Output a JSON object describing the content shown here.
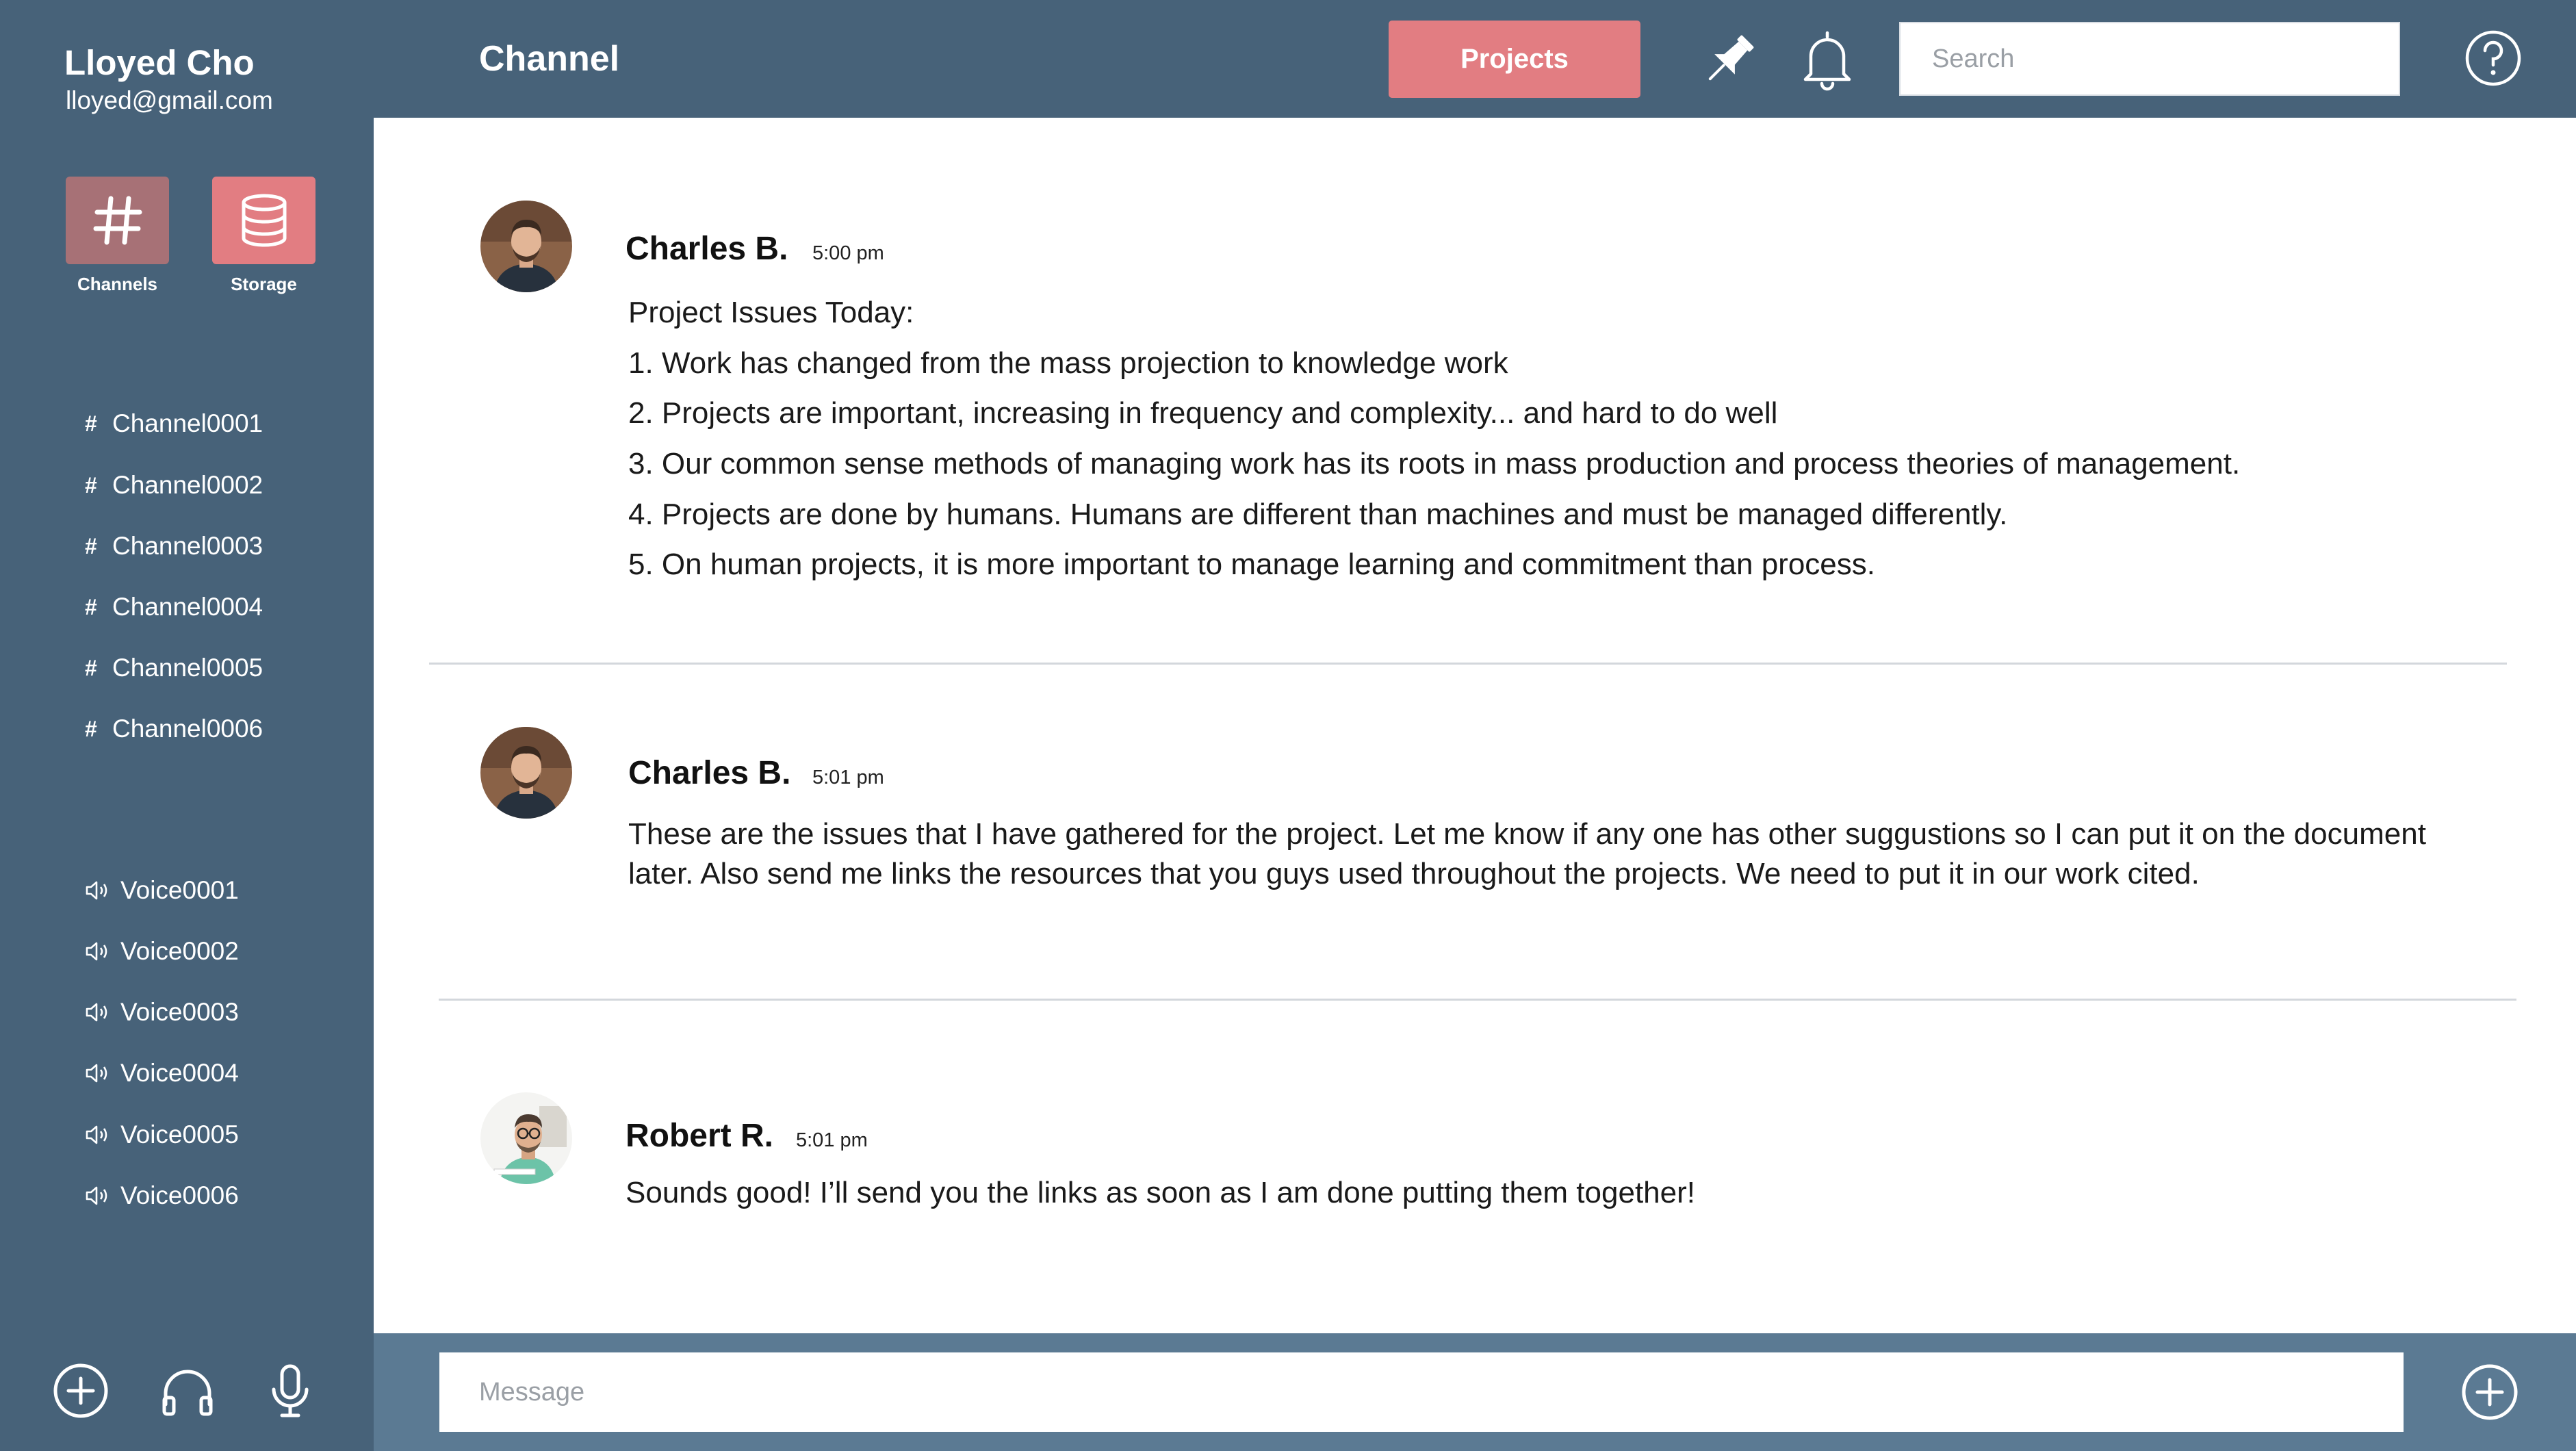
{
  "user": {
    "name": "Lloyed Cho",
    "email": "lloyed@gmail.com"
  },
  "nav": {
    "channels_label": "Channels",
    "storage_label": "Storage",
    "channels_icon": "hash-icon",
    "storage_icon": "database-icon"
  },
  "text_channels": [
    {
      "label": "Channel0001"
    },
    {
      "label": "Channel0002"
    },
    {
      "label": "Channel0003"
    },
    {
      "label": "Channel0004"
    },
    {
      "label": "Channel0005"
    },
    {
      "label": "Channel0006"
    }
  ],
  "voice_channels": [
    {
      "label": "Voice0001"
    },
    {
      "label": "Voice0002"
    },
    {
      "label": "Voice0003"
    },
    {
      "label": "Voice0004"
    },
    {
      "label": "Voice0005"
    },
    {
      "label": "Voice0006"
    }
  ],
  "sidebar_footer_icons": [
    "add-circle-icon",
    "headphones-icon",
    "microphone-icon"
  ],
  "header": {
    "title": "Channel",
    "projects_label": "Projects",
    "search_placeholder": "Search",
    "icons": [
      "pin-icon",
      "bell-icon",
      "help-icon"
    ]
  },
  "messages": [
    {
      "author": "Charles B.",
      "time": "5:00 pm",
      "lines": [
        "Project Issues Today:",
        "1. Work has changed from the mass projection to knowledge work",
        "2. Projects are important, increasing in frequency and complexity... and hard to do well",
        "3. Our common sense methods of managing work has its roots in mass production and process theories of management.",
        "4. Projects are done by humans. Humans are different than machines and must be managed differently.",
        "5. On human projects, it is more important to manage learning and commitment than process."
      ]
    },
    {
      "author": "Charles B.",
      "time": "5:01 pm",
      "text": "These are the issues that I have gathered for the project. Let me know if any one has other suggustions so I can put it on the document later. Also send me links the resources that you guys used throughout the projects. We need to put it in our work cited."
    },
    {
      "author": "Robert R.",
      "time": "5:01 pm",
      "text": "Sounds good! I’ll send you the links as soon as I am done putting them together!"
    }
  ],
  "composer": {
    "placeholder": "Message",
    "add_icon": "add-circle-icon"
  },
  "colors": {
    "sidebar": "#476279",
    "accent": "#e27d82",
    "accent_muted": "#a77176",
    "composer_bar": "#5b7a93"
  }
}
